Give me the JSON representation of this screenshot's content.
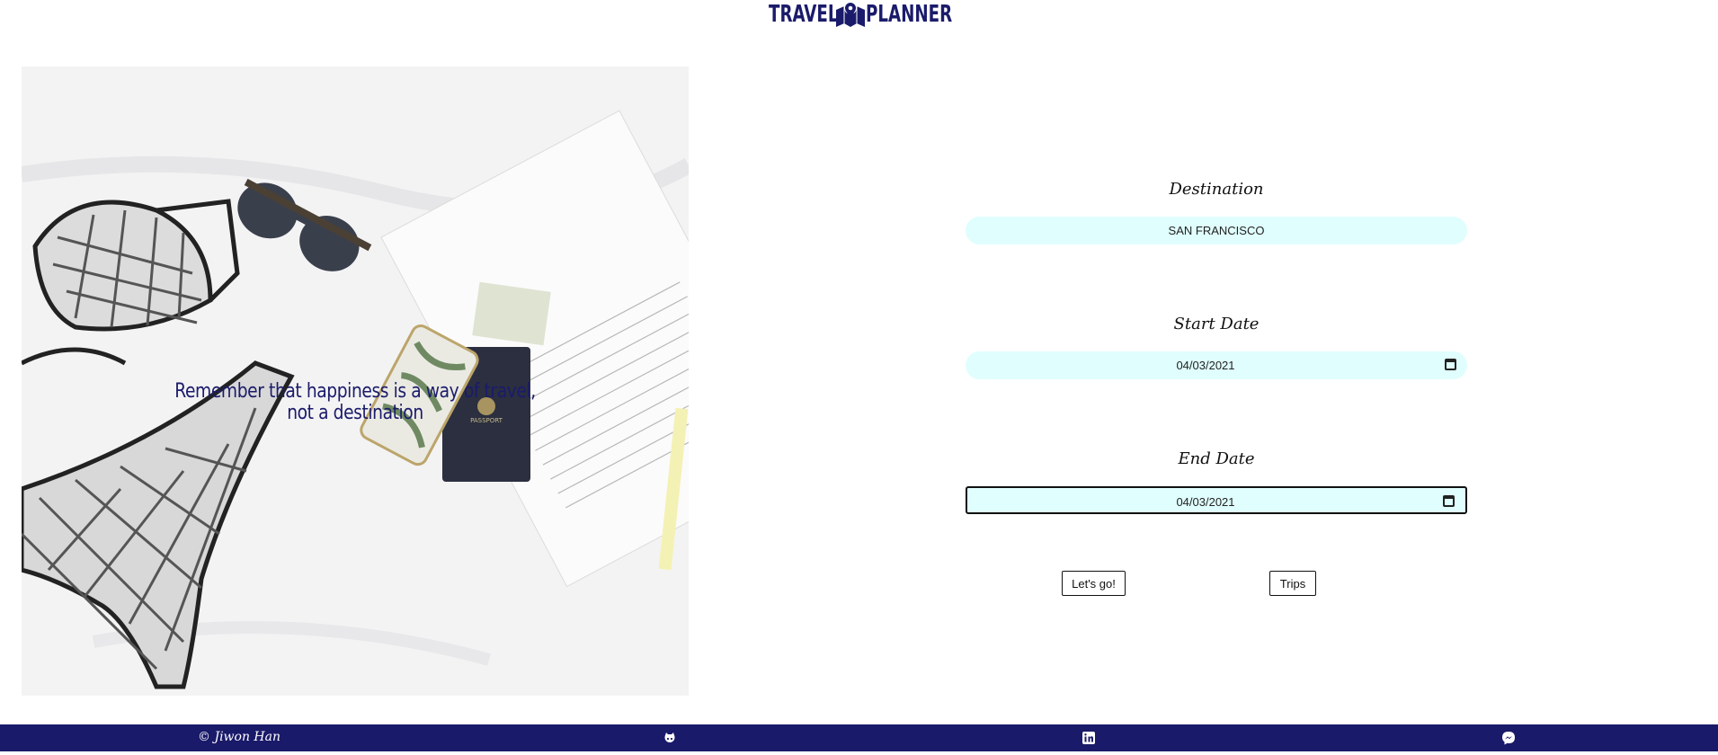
{
  "header": {
    "logo_left": "TRAVEL",
    "logo_right": "PLANNER",
    "logo_icon": "map-pin-icon"
  },
  "hero": {
    "quote_line1": "Remember that happiness is a way of travel,",
    "quote_line2": "not a destination"
  },
  "form": {
    "destination_label": "Destination",
    "destination_value": "SAN FRANCISCO",
    "start_label": "Start Date",
    "start_value": "04/03/2021",
    "end_label": "End Date",
    "end_value": "04/03/2021",
    "go_button": "Let's go!",
    "trips_button": "Trips"
  },
  "footer": {
    "credit": "© Jiwon Han",
    "icons": [
      "github-icon",
      "linkedin-icon",
      "messenger-icon"
    ]
  },
  "colors": {
    "brand": "#1a1a6a",
    "input_bg": "#e0fefe"
  }
}
